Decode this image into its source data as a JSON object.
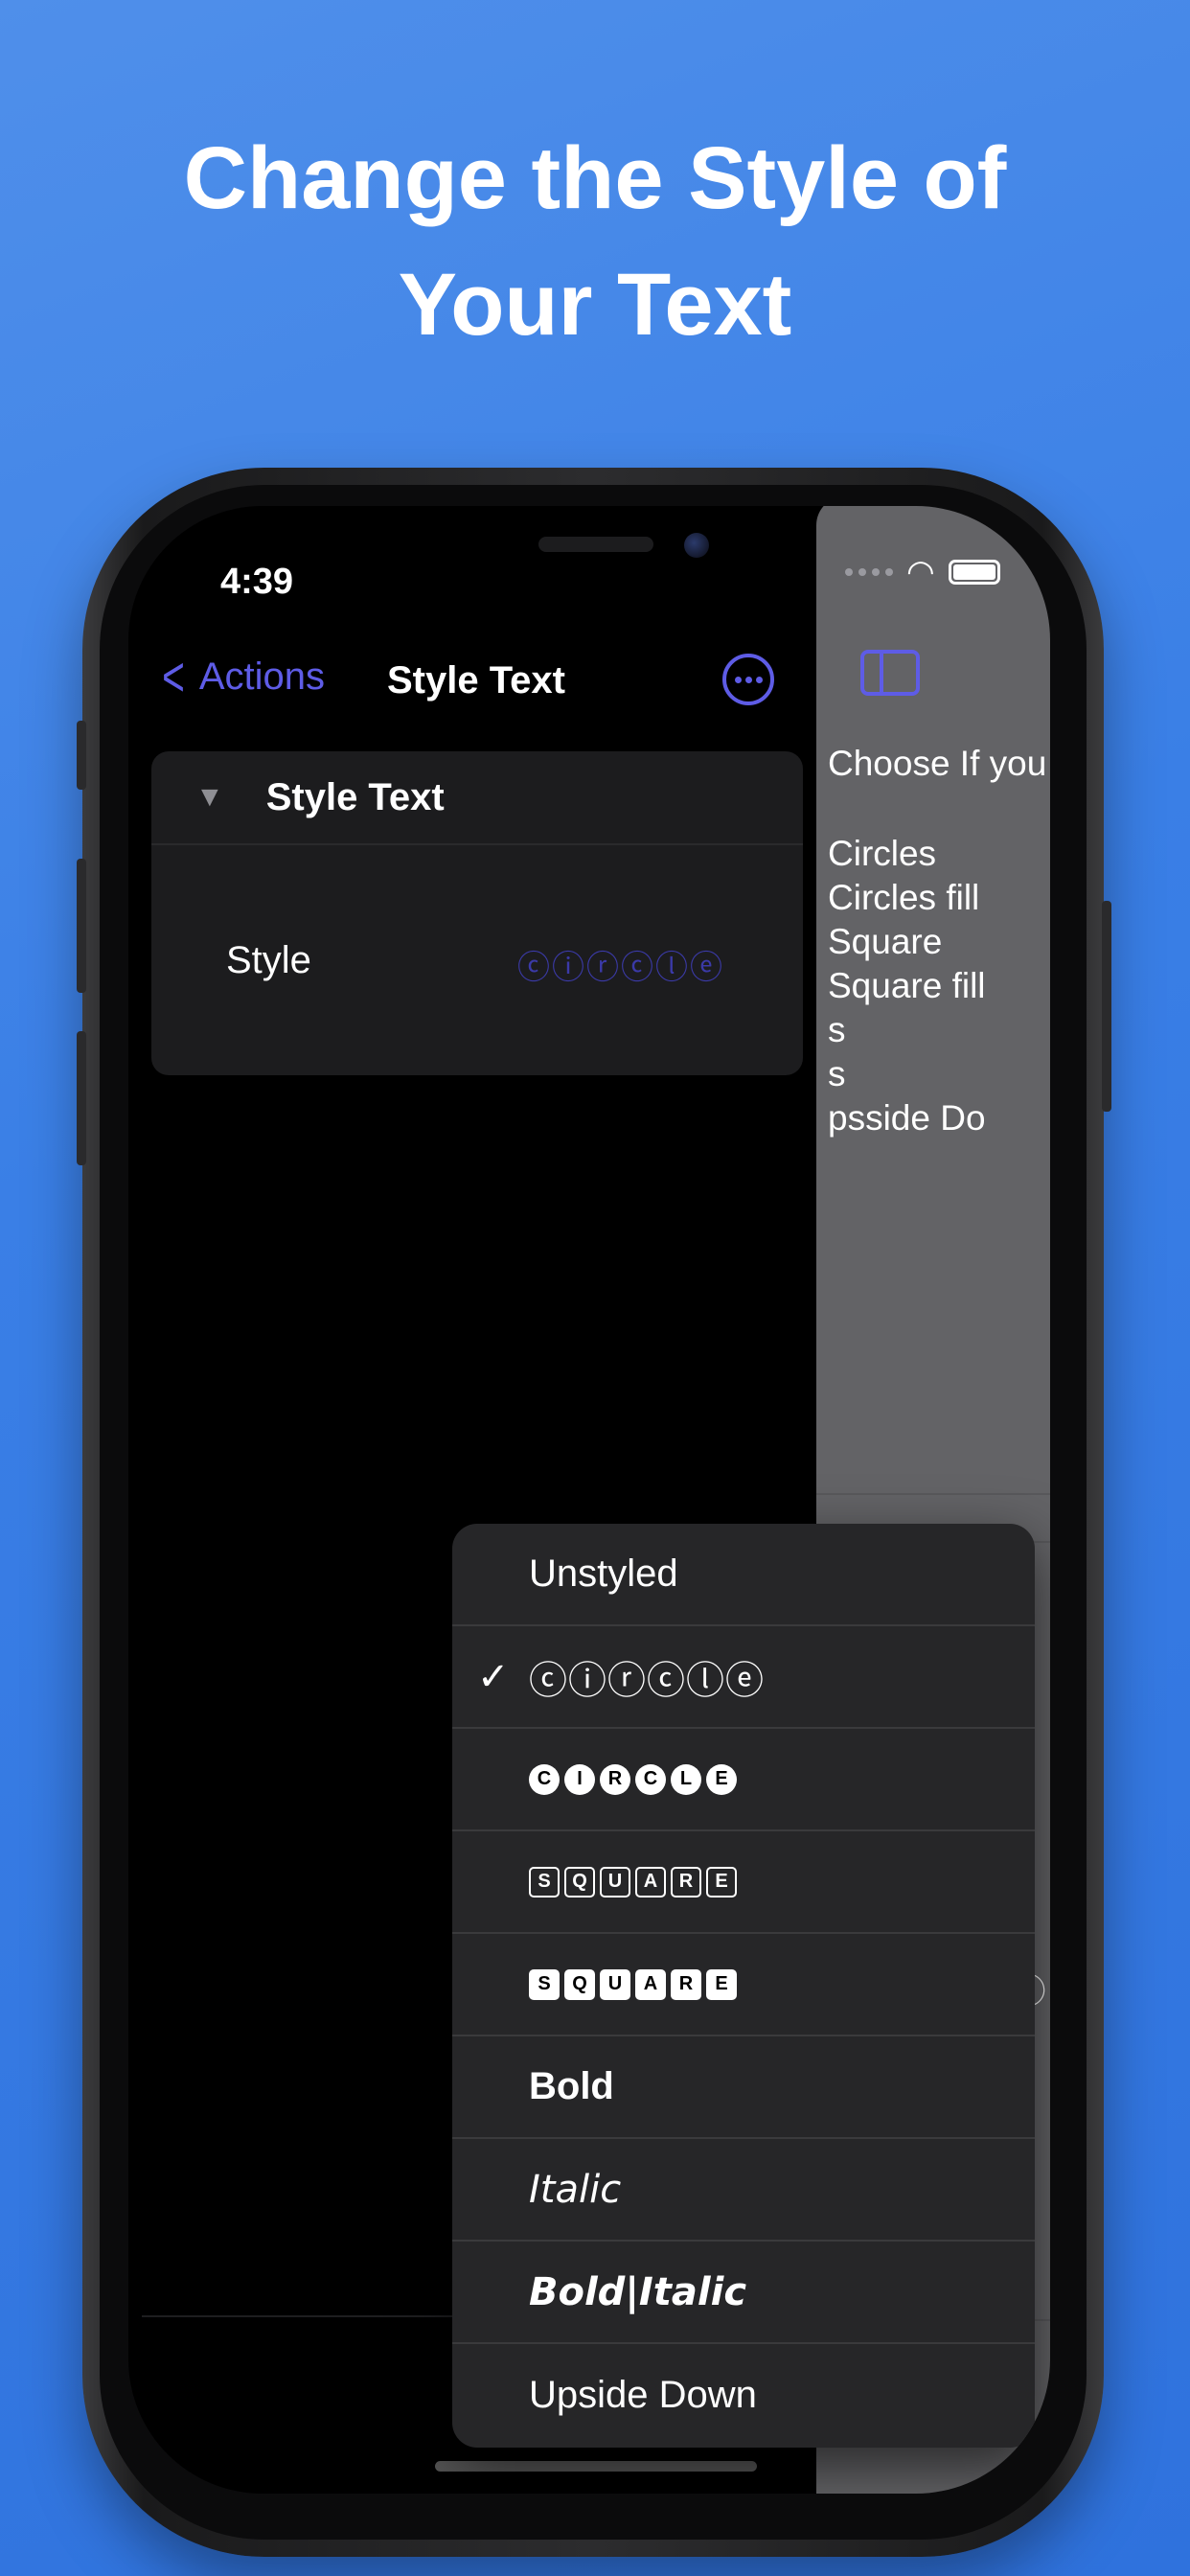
{
  "headline": {
    "line1": "Change the Style of",
    "line2": "Your Text"
  },
  "status": {
    "time": "4:39"
  },
  "nav": {
    "back_label": "Actions",
    "title": "Style Text"
  },
  "card": {
    "title": "Style Text",
    "row_label": "Style",
    "row_value": "ⓒⓘⓡⓒⓛⓔ"
  },
  "menu": {
    "items": [
      {
        "label": "Unstyled",
        "style": "plain",
        "checked": false
      },
      {
        "label": "ⓒⓘⓡⓒⓛⓔ",
        "style": "circle-outline",
        "checked": true
      },
      {
        "label": "CIRCLE",
        "style": "circle-filled",
        "checked": false
      },
      {
        "label": "SQUARE",
        "style": "square-outline",
        "checked": false
      },
      {
        "label": "SQUARE",
        "style": "square-filled",
        "checked": false
      },
      {
        "label": "Bold",
        "style": "bold",
        "checked": false
      },
      {
        "label": "Italic",
        "style": "italic",
        "checked": false
      },
      {
        "label": "Bold|Italic",
        "style": "bold-italic",
        "checked": false
      },
      {
        "label": "Upside Down",
        "style": "plain",
        "checked": false
      }
    ],
    "check_glyph": "✓"
  },
  "right_pane": {
    "prompt": "Choose If you",
    "list": [
      "Circles",
      "Circles fill",
      "Square",
      "Square fill",
      "   s",
      "   s",
      "  psside Do"
    ],
    "circled_lines": [
      "ⓒⓗⓞⓞⓢⓔ",
      "ⓛⓔⓣⓣⓔⓡ",
      "",
      "ⓒⓘⓡⓒⓛⓔ",
      "ⓒⓘⓡⓒⓛⓔ",
      "ⓢⓠⓤⓐⓡⓔ",
      "ⓢⓠⓤⓐⓡⓔ",
      "ⓑⓞⓛⓓⓢ",
      "ⓘⓣⓐⓛⓘⓒ",
      "ⓞⓡ ⓤⓟⓢⓘ"
    ]
  },
  "colors": {
    "accent": "#5e5ce6",
    "background_top": "#4f8fea",
    "background_bottom": "#2f72dd"
  },
  "icons": {
    "back": "chevron-left-icon",
    "more": "ellipsis-circle-icon",
    "disclosure": "triangle-down-icon",
    "run": "play-icon",
    "sidebar": "sidebar-icon",
    "expand": "expand-arrows-icon",
    "wifi": "wifi-icon",
    "battery": "battery-icon",
    "check": "checkmark-icon"
  }
}
